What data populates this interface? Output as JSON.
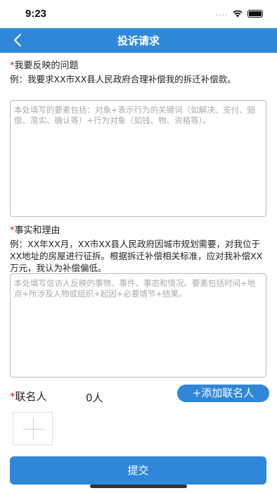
{
  "status_bar": {
    "time": "9:23",
    "signal_text": "....",
    "wifi_icon": "wifi-icon",
    "battery_icon": "battery-icon"
  },
  "nav": {
    "back_icon": "chevron-left-icon",
    "title": "投诉请求"
  },
  "problem_section": {
    "required_mark": "*",
    "title": "我要反映的问题",
    "example": "例：我要求XX市XX县人民政府合理补偿我的拆迁补偿款。",
    "placeholder": "本处填写的要素包括：对象+表示行为的关键词（如解决、支付、赔偿、落实、确认等）+行为对象（如钱、物、资格等）。",
    "value": ""
  },
  "facts_section": {
    "required_mark": "*",
    "title": "事实和理由",
    "example": "例：XX年XX月，XX市XX县人民政府因城市规划需要，对我位于XX地址的房屋进行征拆。根据拆迁补偿相关标准，应对我补偿XX万元，我认为补偿偏低。",
    "placeholder": "本处填写信访人反映的事物、事件、事态和情况。要素包括时间+地点+所涉及人物或组织+起因+必要情节+结果。",
    "value": ""
  },
  "contacts": {
    "required_mark": "*",
    "label": "联名人",
    "count": "0人",
    "add_button": "+添加联名人",
    "add_box_icon": "plus-icon"
  },
  "submit": {
    "label": "提交"
  },
  "colors": {
    "primary": "#2f87d9",
    "required": "#e02020",
    "border": "#bbbbbb"
  }
}
